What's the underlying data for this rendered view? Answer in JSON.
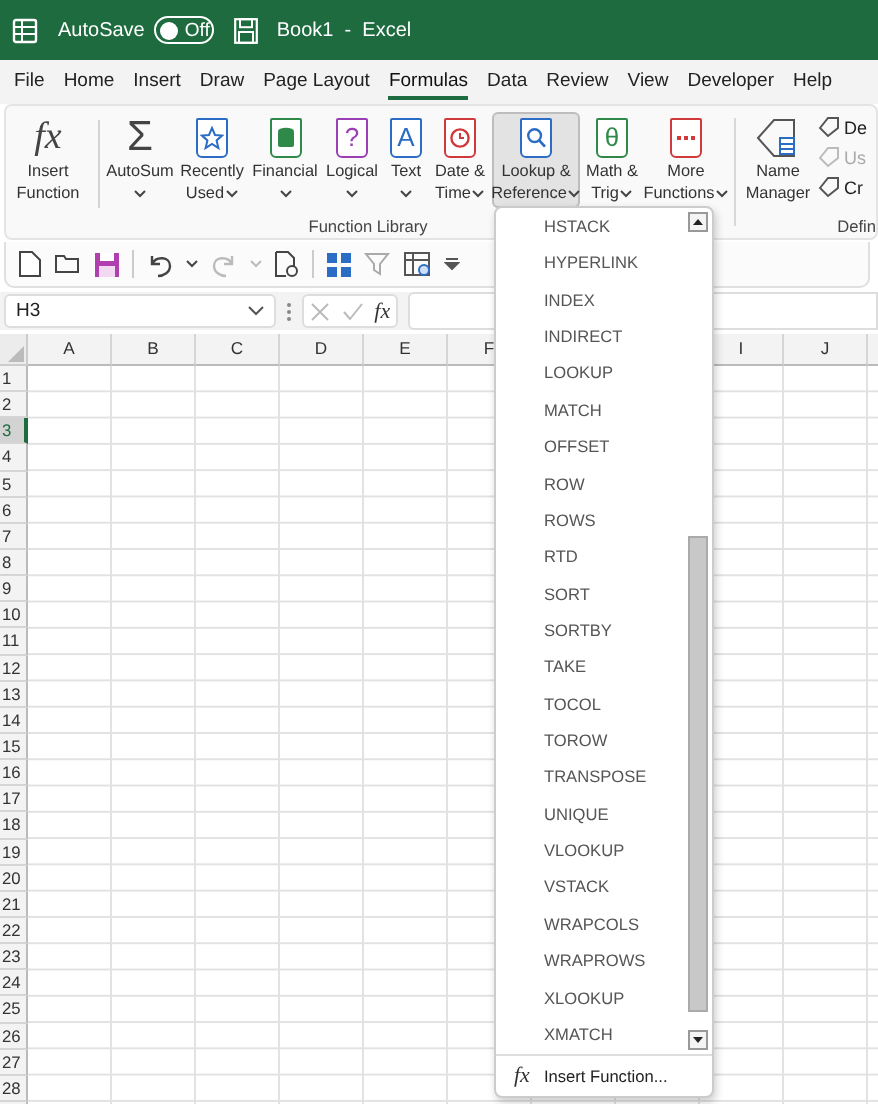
{
  "title_bar": {
    "autosave_label": "AutoSave",
    "autosave": {
      "on": false,
      "label": "Off"
    },
    "title": "Book1  -  Excel"
  },
  "tabs": [
    {
      "label": "File",
      "selected": false
    },
    {
      "label": "Home",
      "selected": false
    },
    {
      "label": "Insert",
      "selected": false
    },
    {
      "label": "Draw",
      "selected": false
    },
    {
      "label": "Page Layout",
      "selected": false
    },
    {
      "label": "Formulas",
      "selected": true
    },
    {
      "label": "Data",
      "selected": false
    },
    {
      "label": "Review",
      "selected": false
    },
    {
      "label": "View",
      "selected": false
    },
    {
      "label": "Developer",
      "selected": false
    },
    {
      "label": "Help",
      "selected": false
    }
  ],
  "ribbon": {
    "function_library": {
      "label": "Function Library",
      "buttons": [
        {
          "icon_text": "fx",
          "lines": [
            "Insert",
            "Function"
          ],
          "dropdown": false,
          "selected": false
        },
        {
          "icon_text": "Σ",
          "lines": [
            "AutoSum"
          ],
          "dropdown": true,
          "selected": false
        },
        {
          "lines": [
            "Recently",
            "Used"
          ],
          "dropdown": true,
          "selected": false
        },
        {
          "lines": [
            "Financial"
          ],
          "dropdown": true,
          "selected": false
        },
        {
          "icon_text": "?",
          "lines": [
            "Logical"
          ],
          "dropdown": true,
          "selected": false
        },
        {
          "icon_text": "A",
          "lines": [
            "Text"
          ],
          "dropdown": true,
          "selected": false
        },
        {
          "lines": [
            "Date &",
            "Time"
          ],
          "dropdown": true,
          "selected": false
        },
        {
          "lines": [
            "Lookup &",
            "Reference"
          ],
          "dropdown": true,
          "selected": true
        },
        {
          "icon_text": "θ",
          "lines": [
            "Math &",
            "Trig"
          ],
          "dropdown": true,
          "selected": false
        },
        {
          "lines": [
            "More",
            "Functions"
          ],
          "dropdown": true,
          "selected": false
        }
      ]
    },
    "defined_names": {
      "label": "Defin",
      "name_manager": [
        "Name",
        "Manager"
      ],
      "small_items": [
        {
          "label": "De",
          "disabled": false
        },
        {
          "label": "Us",
          "disabled": true
        },
        {
          "label": "Cr",
          "disabled": false
        }
      ]
    }
  },
  "formula_bar": {
    "name_box": "H3",
    "fx": "fx"
  },
  "grid": {
    "columns_left": [
      "A",
      "B",
      "C",
      "D",
      "E",
      "F"
    ],
    "columns_right": [
      "I",
      "J"
    ],
    "rows": [
      {
        "label": "1",
        "selected": false
      },
      {
        "label": "2",
        "selected": false
      },
      {
        "label": "3",
        "selected": true
      },
      {
        "label": "4",
        "selected": false
      },
      {
        "label": "5",
        "selected": false
      },
      {
        "label": "6",
        "selected": false
      },
      {
        "label": "7",
        "selected": false
      },
      {
        "label": "8",
        "selected": false
      },
      {
        "label": "9",
        "selected": false
      },
      {
        "label": "10",
        "selected": false
      },
      {
        "label": "11",
        "selected": false
      },
      {
        "label": "12",
        "selected": false
      },
      {
        "label": "13",
        "selected": false
      },
      {
        "label": "14",
        "selected": false
      },
      {
        "label": "15",
        "selected": false
      },
      {
        "label": "16",
        "selected": false
      },
      {
        "label": "17",
        "selected": false
      },
      {
        "label": "18",
        "selected": false
      },
      {
        "label": "19",
        "selected": false
      },
      {
        "label": "20",
        "selected": false
      },
      {
        "label": "21",
        "selected": false
      },
      {
        "label": "22",
        "selected": false
      },
      {
        "label": "23",
        "selected": false
      },
      {
        "label": "24",
        "selected": false
      },
      {
        "label": "25",
        "selected": false
      },
      {
        "label": "26",
        "selected": false
      },
      {
        "label": "27",
        "selected": false
      },
      {
        "label": "28",
        "selected": false
      }
    ]
  },
  "dropdown": {
    "items": [
      "HSTACK",
      "HYPERLINK",
      "INDEX",
      "INDIRECT",
      "LOOKUP",
      "MATCH",
      "OFFSET",
      "ROW",
      "ROWS",
      "RTD",
      "SORT",
      "SORTBY",
      "TAKE",
      "TOCOL",
      "TOROW",
      "TRANSPOSE",
      "UNIQUE",
      "VLOOKUP",
      "VSTACK",
      "WRAPCOLS",
      "WRAPROWS",
      "XLOOKUP",
      "XMATCH"
    ],
    "footer": {
      "icon_text": "fx",
      "label": "Insert Function..."
    }
  }
}
